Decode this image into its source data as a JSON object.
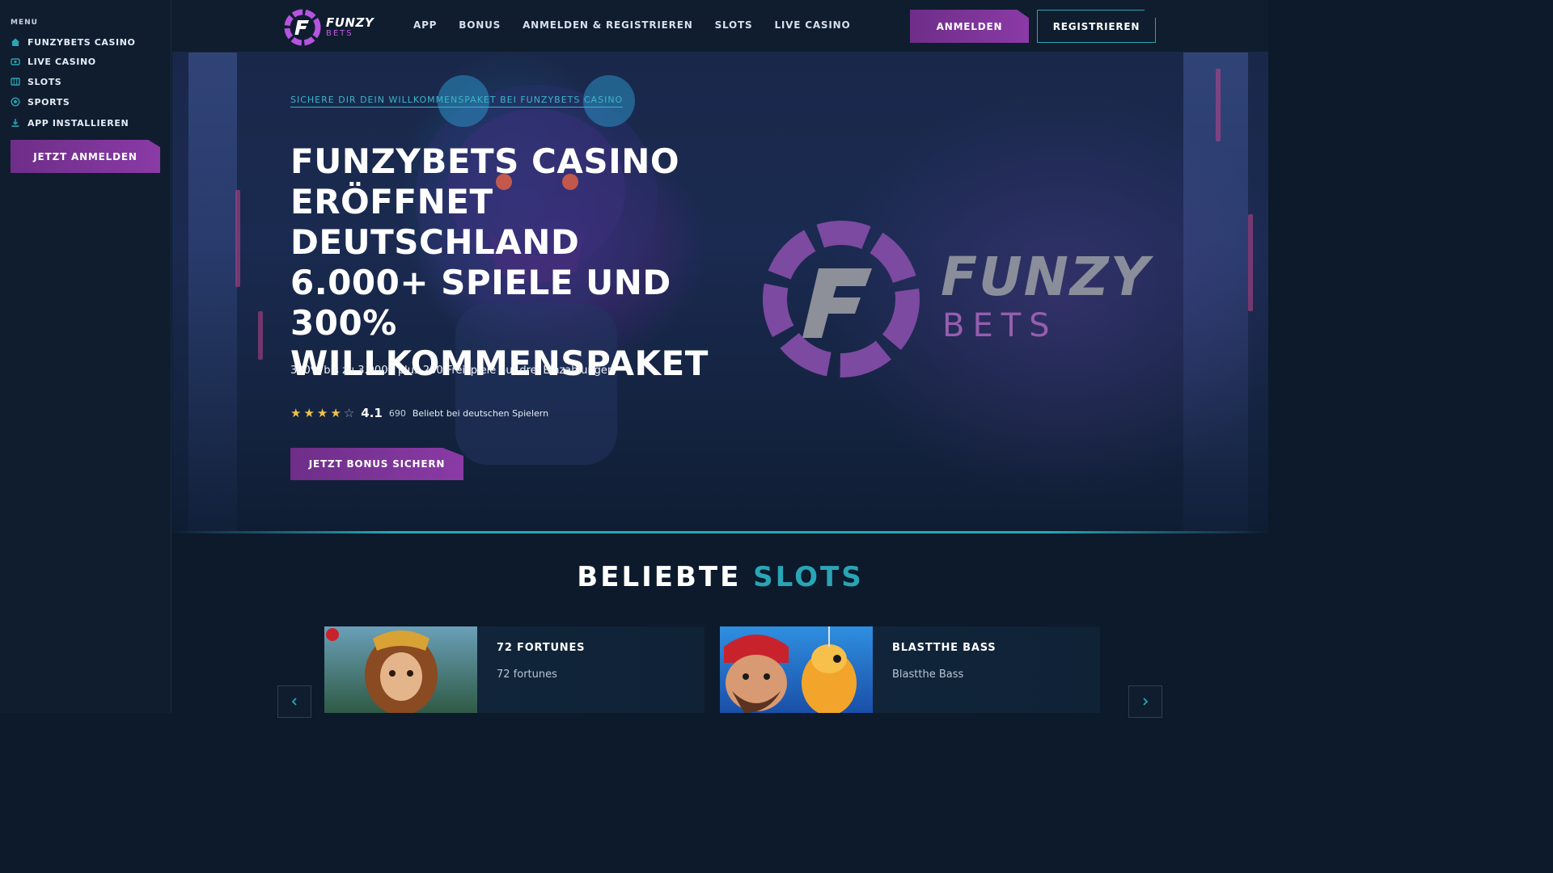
{
  "sidebar": {
    "menu_title": "MENU",
    "items": [
      {
        "label": "FUNZYBETS CASINO",
        "icon": "home-icon"
      },
      {
        "label": "LIVE CASINO",
        "icon": "live-casino-icon"
      },
      {
        "label": "SLOTS",
        "icon": "slots-icon"
      },
      {
        "label": "SPORTS",
        "icon": "sports-icon"
      },
      {
        "label": "APP INSTALLIEREN",
        "icon": "download-icon"
      }
    ],
    "cta": "JETZT ANMELDEN"
  },
  "header": {
    "logo_line1": "FUNZY",
    "logo_line2": "BETS",
    "nav": [
      "APP",
      "BONUS",
      "ANMELDEN & REGISTRIEREN",
      "SLOTS",
      "LIVE CASINO"
    ],
    "login": "ANMELDEN",
    "register": "REGISTRIEREN"
  },
  "hero": {
    "kicker": "SICHERE DIR DEIN WILLKOMMENSPAKET BEI FUNZYBETS CASINO",
    "title": "FUNZYBETS CASINO ERÖFFNET DEUTSCHLAND 6.000+ SPIELE UND 300% WILLKOMMENSPAKET",
    "description": "300% bis zu 3.000€ plus 200 Freispiele auf drei Einzahlungen",
    "rating_value": "4.1",
    "rating_stars": 4,
    "rating_count": "690",
    "rating_label": "Beliebt bei deutschen Spielern",
    "cta": "JETZT BONUS SICHERN",
    "brand_word": "FUNZY",
    "brand_word2": "BETS"
  },
  "slots_section": {
    "title_part1": "BELIEBTE",
    "title_part2": "SLOTS",
    "cards": [
      {
        "title": "72 FORTUNES",
        "subtitle": "72 fortunes"
      },
      {
        "title": "BLASTTHE BASS",
        "subtitle": "Blastthe Bass"
      }
    ]
  },
  "colors": {
    "accent_purple": "#8a3aa6",
    "accent_teal": "#2aa5b5",
    "background": "#0c1a2c"
  }
}
